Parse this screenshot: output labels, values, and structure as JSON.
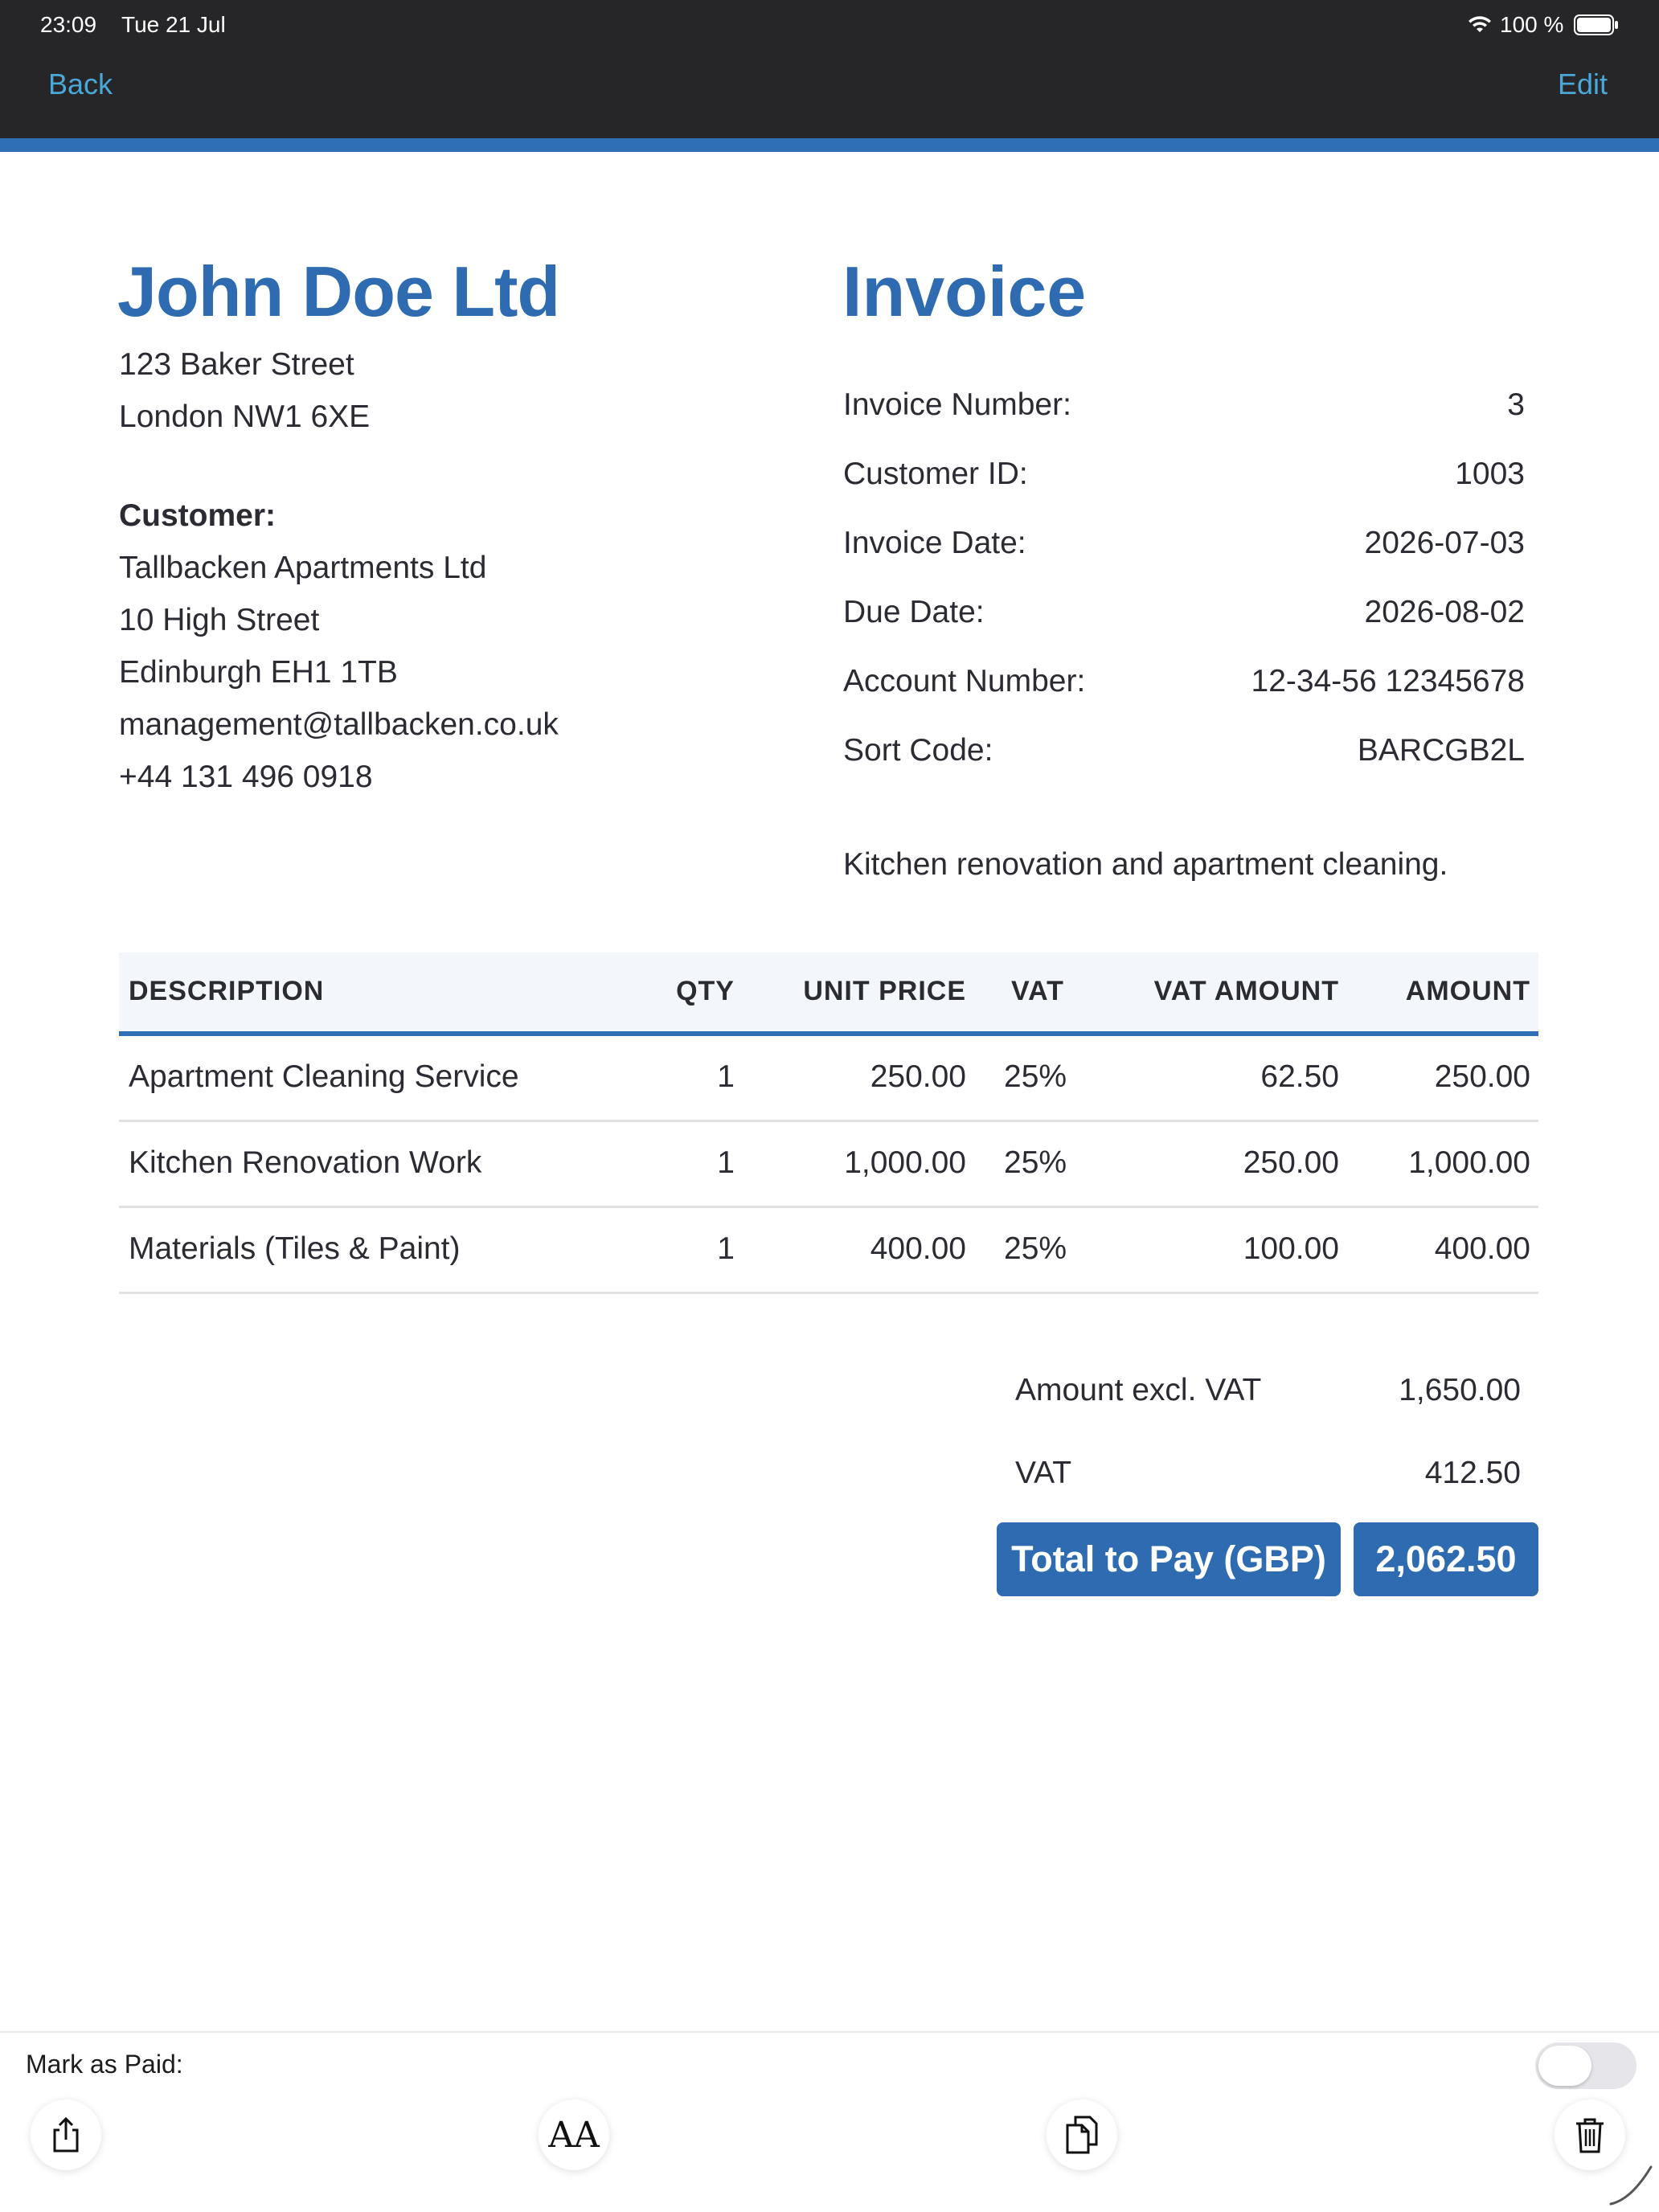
{
  "status_bar": {
    "time": "23:09",
    "date": "Tue 21 Jul",
    "battery": "100 %"
  },
  "nav": {
    "back_label": "Back",
    "edit_label": "Edit"
  },
  "company": {
    "name": "John Doe Ltd",
    "address_line1": "123 Baker Street",
    "address_line2": "London NW1 6XE"
  },
  "customer": {
    "heading": "Customer:",
    "name": "Tallbacken Apartments Ltd",
    "street": "10 High Street",
    "city": "Edinburgh EH1 1TB",
    "email": "management@tallbacken.co.uk",
    "phone": "+44 131 496 0918"
  },
  "invoice": {
    "title": "Invoice",
    "fields": [
      {
        "label": "Invoice Number:",
        "value": "3"
      },
      {
        "label": "Customer ID:",
        "value": "1003"
      },
      {
        "label": "Invoice Date:",
        "value": "2026-07-03"
      },
      {
        "label": "Due Date:",
        "value": "2026-08-02"
      },
      {
        "label": "Account Number:",
        "value": "12-34-56 12345678"
      },
      {
        "label": "Sort Code:",
        "value": "BARCGB2L"
      }
    ],
    "note": "Kitchen renovation and apartment cleaning."
  },
  "table": {
    "headers": [
      "DESCRIPTION",
      "QTY",
      "UNIT PRICE",
      "VAT",
      "VAT AMOUNT",
      "AMOUNT"
    ],
    "rows": [
      [
        "Apartment Cleaning Service",
        "1",
        "250.00",
        "25%",
        "62.50",
        "250.00"
      ],
      [
        "Kitchen Renovation Work",
        "1",
        "1,000.00",
        "25%",
        "250.00",
        "1,000.00"
      ],
      [
        "Materials (Tiles & Paint)",
        "1",
        "400.00",
        "25%",
        "100.00",
        "400.00"
      ]
    ]
  },
  "totals": {
    "excl_label": "Amount excl. VAT",
    "excl_value": "1,650.00",
    "vat_label": "VAT",
    "vat_value": "412.50",
    "total_label": "Total to Pay (GBP)",
    "total_value": "2,062.50"
  },
  "bottom": {
    "mark_paid_label": "Mark as Paid:",
    "mark_paid_on": false,
    "font_button_glyph": "AA"
  },
  "colors": {
    "accent": "#2e6fb5",
    "link": "#4aa8d8",
    "topbar": "#262628"
  }
}
